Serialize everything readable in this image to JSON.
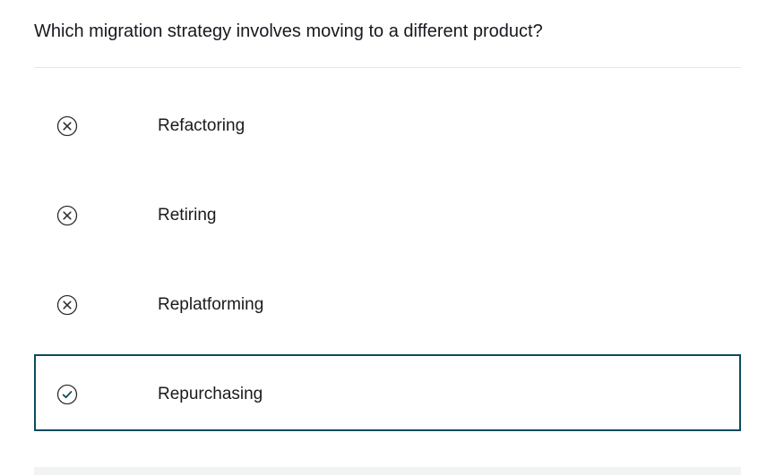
{
  "question": {
    "text": "Which migration strategy involves moving to a different product?"
  },
  "options": [
    {
      "label": "Refactoring",
      "status": "incorrect",
      "icon": "x-circle-icon"
    },
    {
      "label": "Retiring",
      "status": "incorrect",
      "icon": "x-circle-icon"
    },
    {
      "label": "Replatforming",
      "status": "incorrect",
      "icon": "x-circle-icon"
    },
    {
      "label": "Repurchasing",
      "status": "correct",
      "icon": "check-circle-icon"
    }
  ],
  "colors": {
    "correct_border": "#0f4a5e",
    "icon_stroke": "#2b2b2b",
    "divider": "#e6e6e6"
  }
}
